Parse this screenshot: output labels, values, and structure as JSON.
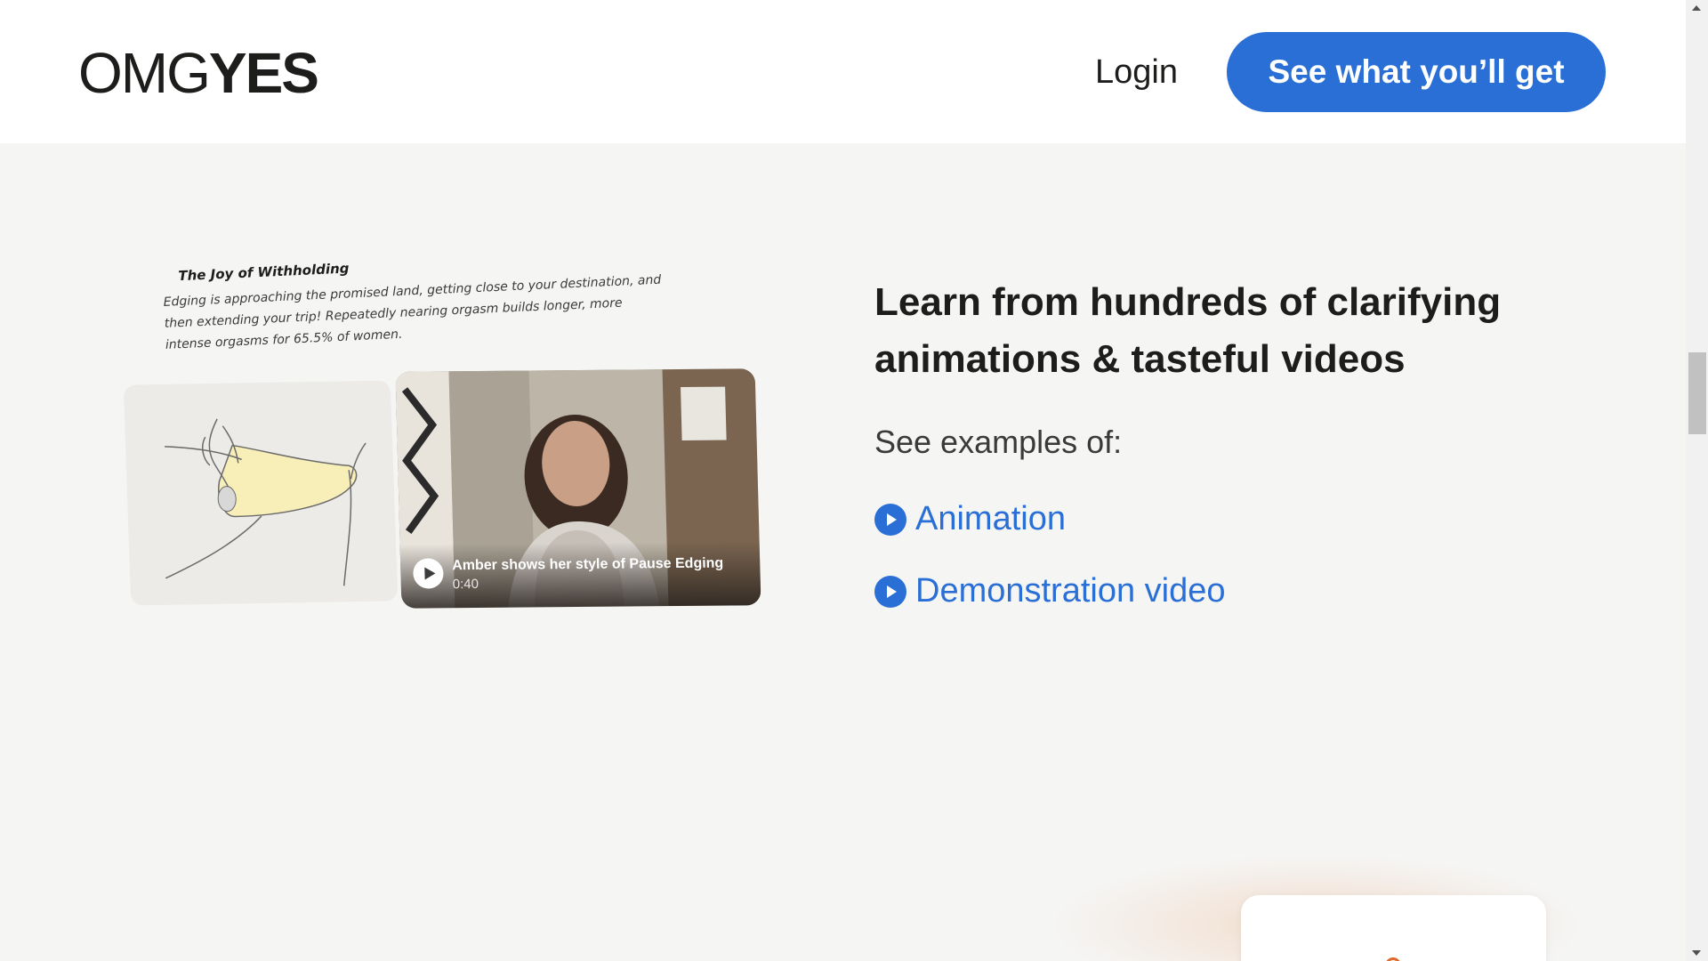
{
  "header": {
    "logo_light": "OMG",
    "logo_bold": "YES",
    "login_label": "Login",
    "cta_label": "See what you’ll get"
  },
  "media": {
    "caption_title": "The Joy of Withholding",
    "caption_text": "Edging is approaching the promised land, getting close to your destination, and then extending your trip! Repeatedly nearing orgasm builds longer, more intense orgasms for 65.5% of women.",
    "video_title": "Amber shows her style of Pause Edging",
    "video_duration": "0:40"
  },
  "content": {
    "headline": "Learn from hundreds of clarifying animations & tasteful videos",
    "see_examples_label": "See examples of:",
    "examples": [
      {
        "label": "Animation",
        "icon": "play-circle-icon"
      },
      {
        "label": "Demonstration video",
        "icon": "play-circle-icon"
      }
    ]
  },
  "colors": {
    "accent": "#2a6fd6",
    "page_bg": "#f5f5f4",
    "header_bg": "#ffffff",
    "text": "#1d1d1b"
  }
}
